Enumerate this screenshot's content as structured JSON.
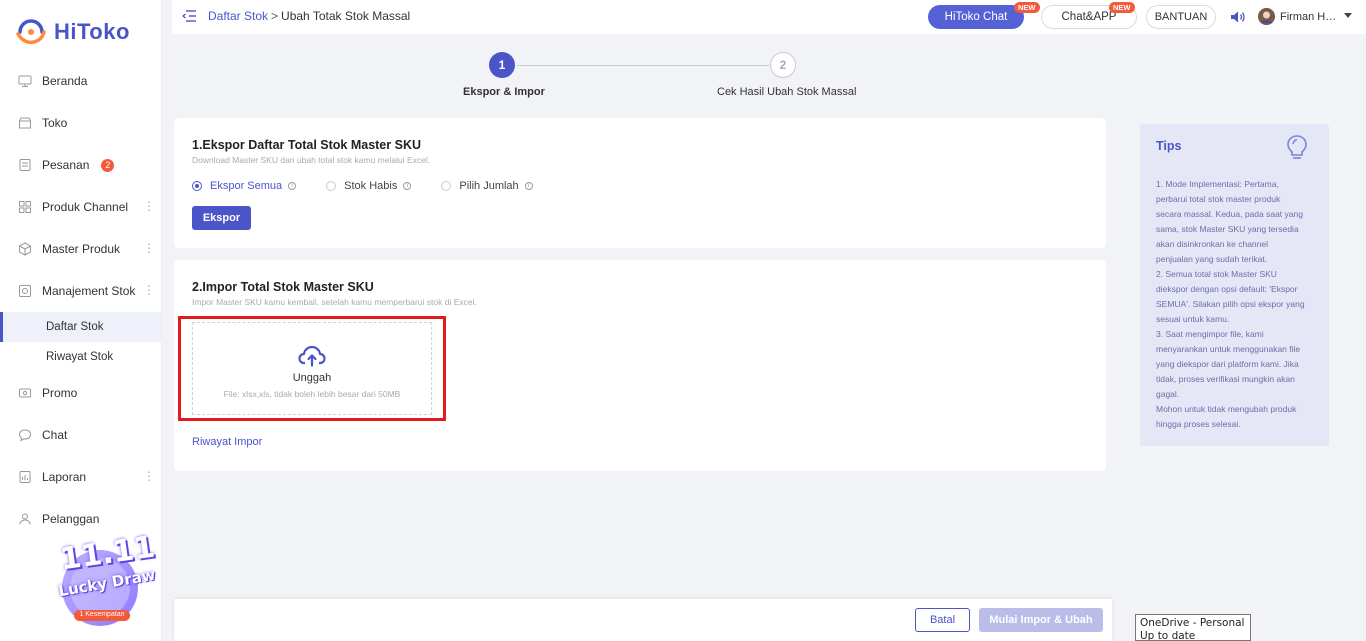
{
  "brand": {
    "name": "HiToko",
    "color": "#4a55c8"
  },
  "sidebar": {
    "items": [
      {
        "label": "Beranda",
        "icon": "monitor-icon"
      },
      {
        "label": "Toko",
        "icon": "store-icon"
      },
      {
        "label": "Pesanan",
        "icon": "orders-icon",
        "badge": "2"
      },
      {
        "label": "Produk Channel",
        "icon": "grid-icon"
      },
      {
        "label": "Master Produk",
        "icon": "cube-icon"
      },
      {
        "label": "Manajement Stok",
        "icon": "stock-icon"
      }
    ],
    "sub_items": [
      {
        "label": "Daftar Stok",
        "active": true
      },
      {
        "label": "Riwayat Stok",
        "active": false
      }
    ],
    "items_after": [
      {
        "label": "Promo",
        "icon": "promo-icon"
      },
      {
        "label": "Chat",
        "icon": "chat-icon"
      },
      {
        "label": "Laporan",
        "icon": "report-icon"
      },
      {
        "label": "Pelanggan",
        "icon": "customer-icon"
      }
    ],
    "promo": {
      "title": "11.11",
      "subtitle": "Lucky Draw",
      "tag": "1 Kesempatan"
    }
  },
  "topbar": {
    "breadcrumb": {
      "parent": "Daftar Stok",
      "separator": ">",
      "current": "Ubah Totak Stok Massal"
    },
    "hitoko_chat": "HiToko Chat",
    "chat_app": "Chat&APP",
    "new_tag": "NEW",
    "bantuan": "BANTUAN",
    "username": "Firman Hit..."
  },
  "stepper": {
    "steps": [
      {
        "number": "1",
        "label": "Ekspor & Impor",
        "active": true
      },
      {
        "number": "2",
        "label": "Cek Hasil Ubah Stok Massal",
        "active": false
      }
    ]
  },
  "export_card": {
    "title": "1.Ekspor Daftar Total Stok Master SKU",
    "subtitle": "Download Master SKU dan ubah total stok kamu melalui Excel.",
    "options": [
      {
        "label": "Ekspor Semua",
        "selected": true
      },
      {
        "label": "Stok Habis",
        "selected": false
      },
      {
        "label": "Pilih Jumlah",
        "selected": false
      }
    ],
    "button": "Ekspor"
  },
  "import_card": {
    "title": "2.Impor Total Stok Master SKU",
    "subtitle": "Impor Master SKU kamu kembali, setelah kamu memperbarui stok di Excel.",
    "upload_label": "Unggah",
    "upload_hint": "File: xlsx,xls, tidak boleh lebih besar dari 50MB",
    "history_link": "Riwayat Impor"
  },
  "tips": {
    "title": "Tips",
    "lines": [
      "1. Mode Implementasi: Pertama,",
      "perbarui total stok master produk",
      "secara massal. Kedua, pada saat yang",
      "sama, stok Master SKU yang tersedia",
      "akan disinkronkan ke channel",
      "penjualan yang sudah terikat.",
      "2. Semua total stok Master SKU",
      "diekspor dengan opsi default: 'Ekspor",
      "SEMUA'. Silakan pilih opsi ekspor yang",
      "sesuai untuk kamu.",
      "3. Saat mengimpor file, kami",
      "menyarankan untuk menggunakan file",
      "yang diekspor dari platform kami. Jika",
      "tidak, proses verifikasi mungkin akan",
      "gagal.",
      "Mohon untuk tidak mengubah produk",
      "hingga proses selesai."
    ]
  },
  "footer": {
    "cancel": "Batal",
    "submit": "Mulai Impor & Ubah"
  },
  "onedrive": {
    "line1": "OneDrive - Personal",
    "line2": "Up to date"
  }
}
